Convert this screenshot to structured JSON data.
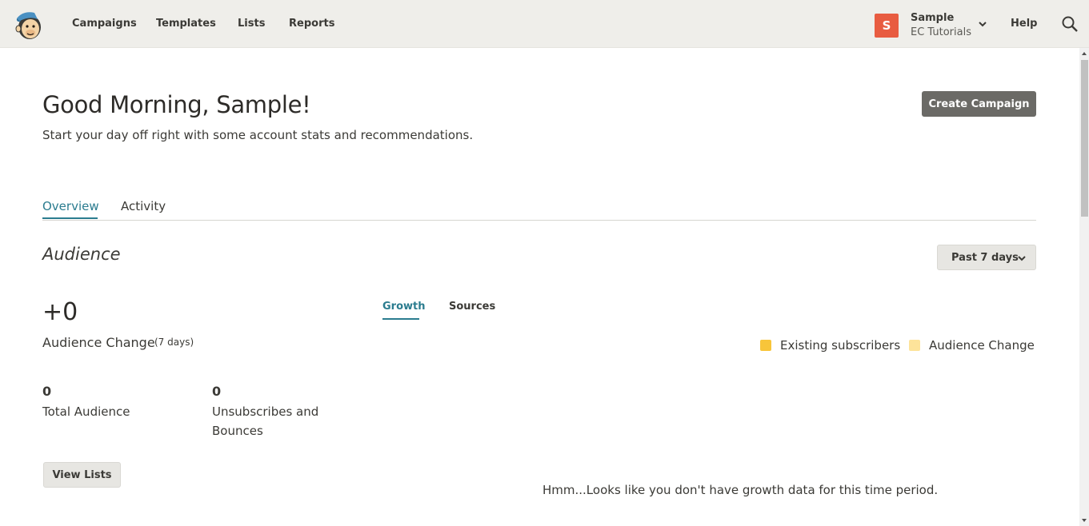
{
  "nav": {
    "items": [
      {
        "label": "Campaigns"
      },
      {
        "label": "Templates"
      },
      {
        "label": "Lists"
      },
      {
        "label": "Reports"
      }
    ],
    "account": {
      "initial": "S",
      "name": "Sample",
      "org": "EC Tutorials"
    },
    "help_label": "Help",
    "icons": {
      "logo": "mailchimp-logo",
      "chevron": "chevron-down-icon",
      "search": "search-icon"
    }
  },
  "header": {
    "greeting": "Good Morning, Sample!",
    "subtext": "Start your day off right with some account stats and recommendations.",
    "create_button": "Create Campaign"
  },
  "tabs": [
    {
      "label": "Overview",
      "active": true
    },
    {
      "label": "Activity",
      "active": false
    }
  ],
  "audience": {
    "title": "Audience",
    "range_label": "Past 7 days",
    "change_value": "+0",
    "change_label": "Audience Change",
    "change_period": "(7 days)",
    "stats": [
      {
        "value": "0",
        "label": "Total Audience"
      },
      {
        "value": "0",
        "label": "Unsubscribes and Bounces"
      }
    ],
    "view_lists_button": "View Lists",
    "chart_tabs": [
      {
        "label": "Growth",
        "active": true
      },
      {
        "label": "Sources",
        "active": false
      }
    ],
    "legend": [
      {
        "label": "Existing subscribers",
        "color": "#f8c53a"
      },
      {
        "label": "Audience Change",
        "color": "#fde39a"
      }
    ],
    "empty_message": "Hmm...Looks like you don't have growth data for this time period."
  },
  "colors": {
    "accent": "#2b7c8f",
    "topbar": "#efeeea",
    "avatar": "#e85c41",
    "primary_button": "#6b6a66"
  }
}
